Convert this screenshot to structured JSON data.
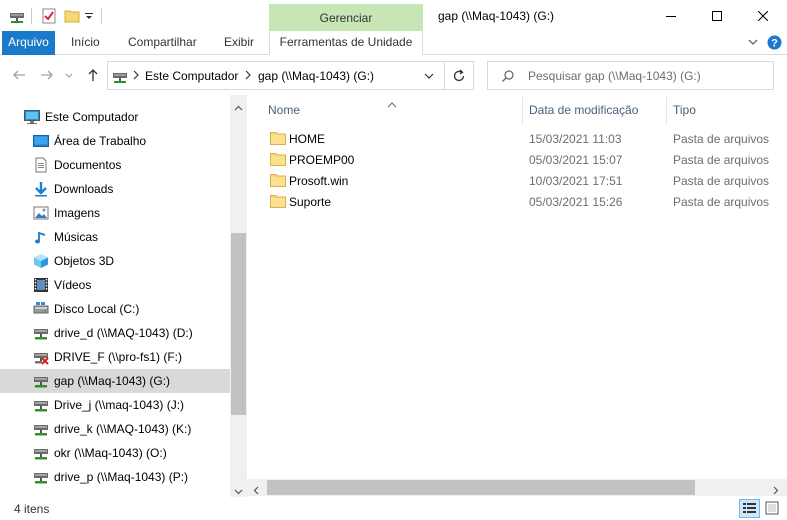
{
  "window": {
    "title": "gap (\\\\Maq-1043) (G:)",
    "context_tab": "Gerenciar"
  },
  "ribbon": {
    "tabs": [
      "Arquivo",
      "Início",
      "Compartilhar",
      "Exibir",
      "Ferramentas de Unidade"
    ]
  },
  "address": {
    "crumbs": [
      "Este Computador",
      "gap (\\\\Maq-1043) (G:)"
    ],
    "search_placeholder": "Pesquisar gap (\\\\Maq-1043) (G:)"
  },
  "nav": {
    "items": [
      {
        "label": "Este Computador",
        "icon": "computer-icon"
      },
      {
        "label": "Área de Trabalho",
        "icon": "desktop-icon"
      },
      {
        "label": "Documentos",
        "icon": "documents-icon"
      },
      {
        "label": "Downloads",
        "icon": "downloads-icon"
      },
      {
        "label": "Imagens",
        "icon": "pictures-icon"
      },
      {
        "label": "Músicas",
        "icon": "music-icon"
      },
      {
        "label": "Objetos 3D",
        "icon": "objects3d-icon"
      },
      {
        "label": "Vídeos",
        "icon": "videos-icon"
      },
      {
        "label": "Disco Local (C:)",
        "icon": "local-disk-icon"
      },
      {
        "label": "drive_d (\\\\MAQ-1043) (D:)",
        "icon": "network-drive-icon"
      },
      {
        "label": "DRIVE_F (\\\\pro-fs1) (F:)",
        "icon": "disconnected-drive-icon"
      },
      {
        "label": "gap (\\\\Maq-1043) (G:)",
        "icon": "network-drive-icon",
        "selected": true
      },
      {
        "label": "Drive_j (\\\\maq-1043) (J:)",
        "icon": "network-drive-icon"
      },
      {
        "label": "drive_k (\\\\MAQ-1043) (K:)",
        "icon": "network-drive-icon"
      },
      {
        "label": "okr (\\\\Maq-1043) (O:)",
        "icon": "network-drive-icon"
      },
      {
        "label": "drive_p (\\\\Maq-1043) (P:)",
        "icon": "network-drive-icon"
      }
    ]
  },
  "content": {
    "columns": [
      "Nome",
      "Data de modificação",
      "Tipo"
    ],
    "rows": [
      {
        "name": "HOME",
        "date": "15/03/2021 11:03",
        "type": "Pasta de arquivos"
      },
      {
        "name": "PROEMP00",
        "date": "05/03/2021 15:07",
        "type": "Pasta de arquivos"
      },
      {
        "name": "Prosoft.win",
        "date": "10/03/2021 17:51",
        "type": "Pasta de arquivos"
      },
      {
        "name": "Suporte",
        "date": "05/03/2021 15:26",
        "type": "Pasta de arquivos"
      }
    ]
  },
  "status": {
    "item_count": "4 itens"
  },
  "colors": {
    "accent": "#1979ca",
    "context_tab": "#c8e6b5",
    "folder": "#f8d775",
    "selection": "#d9d9d9"
  }
}
